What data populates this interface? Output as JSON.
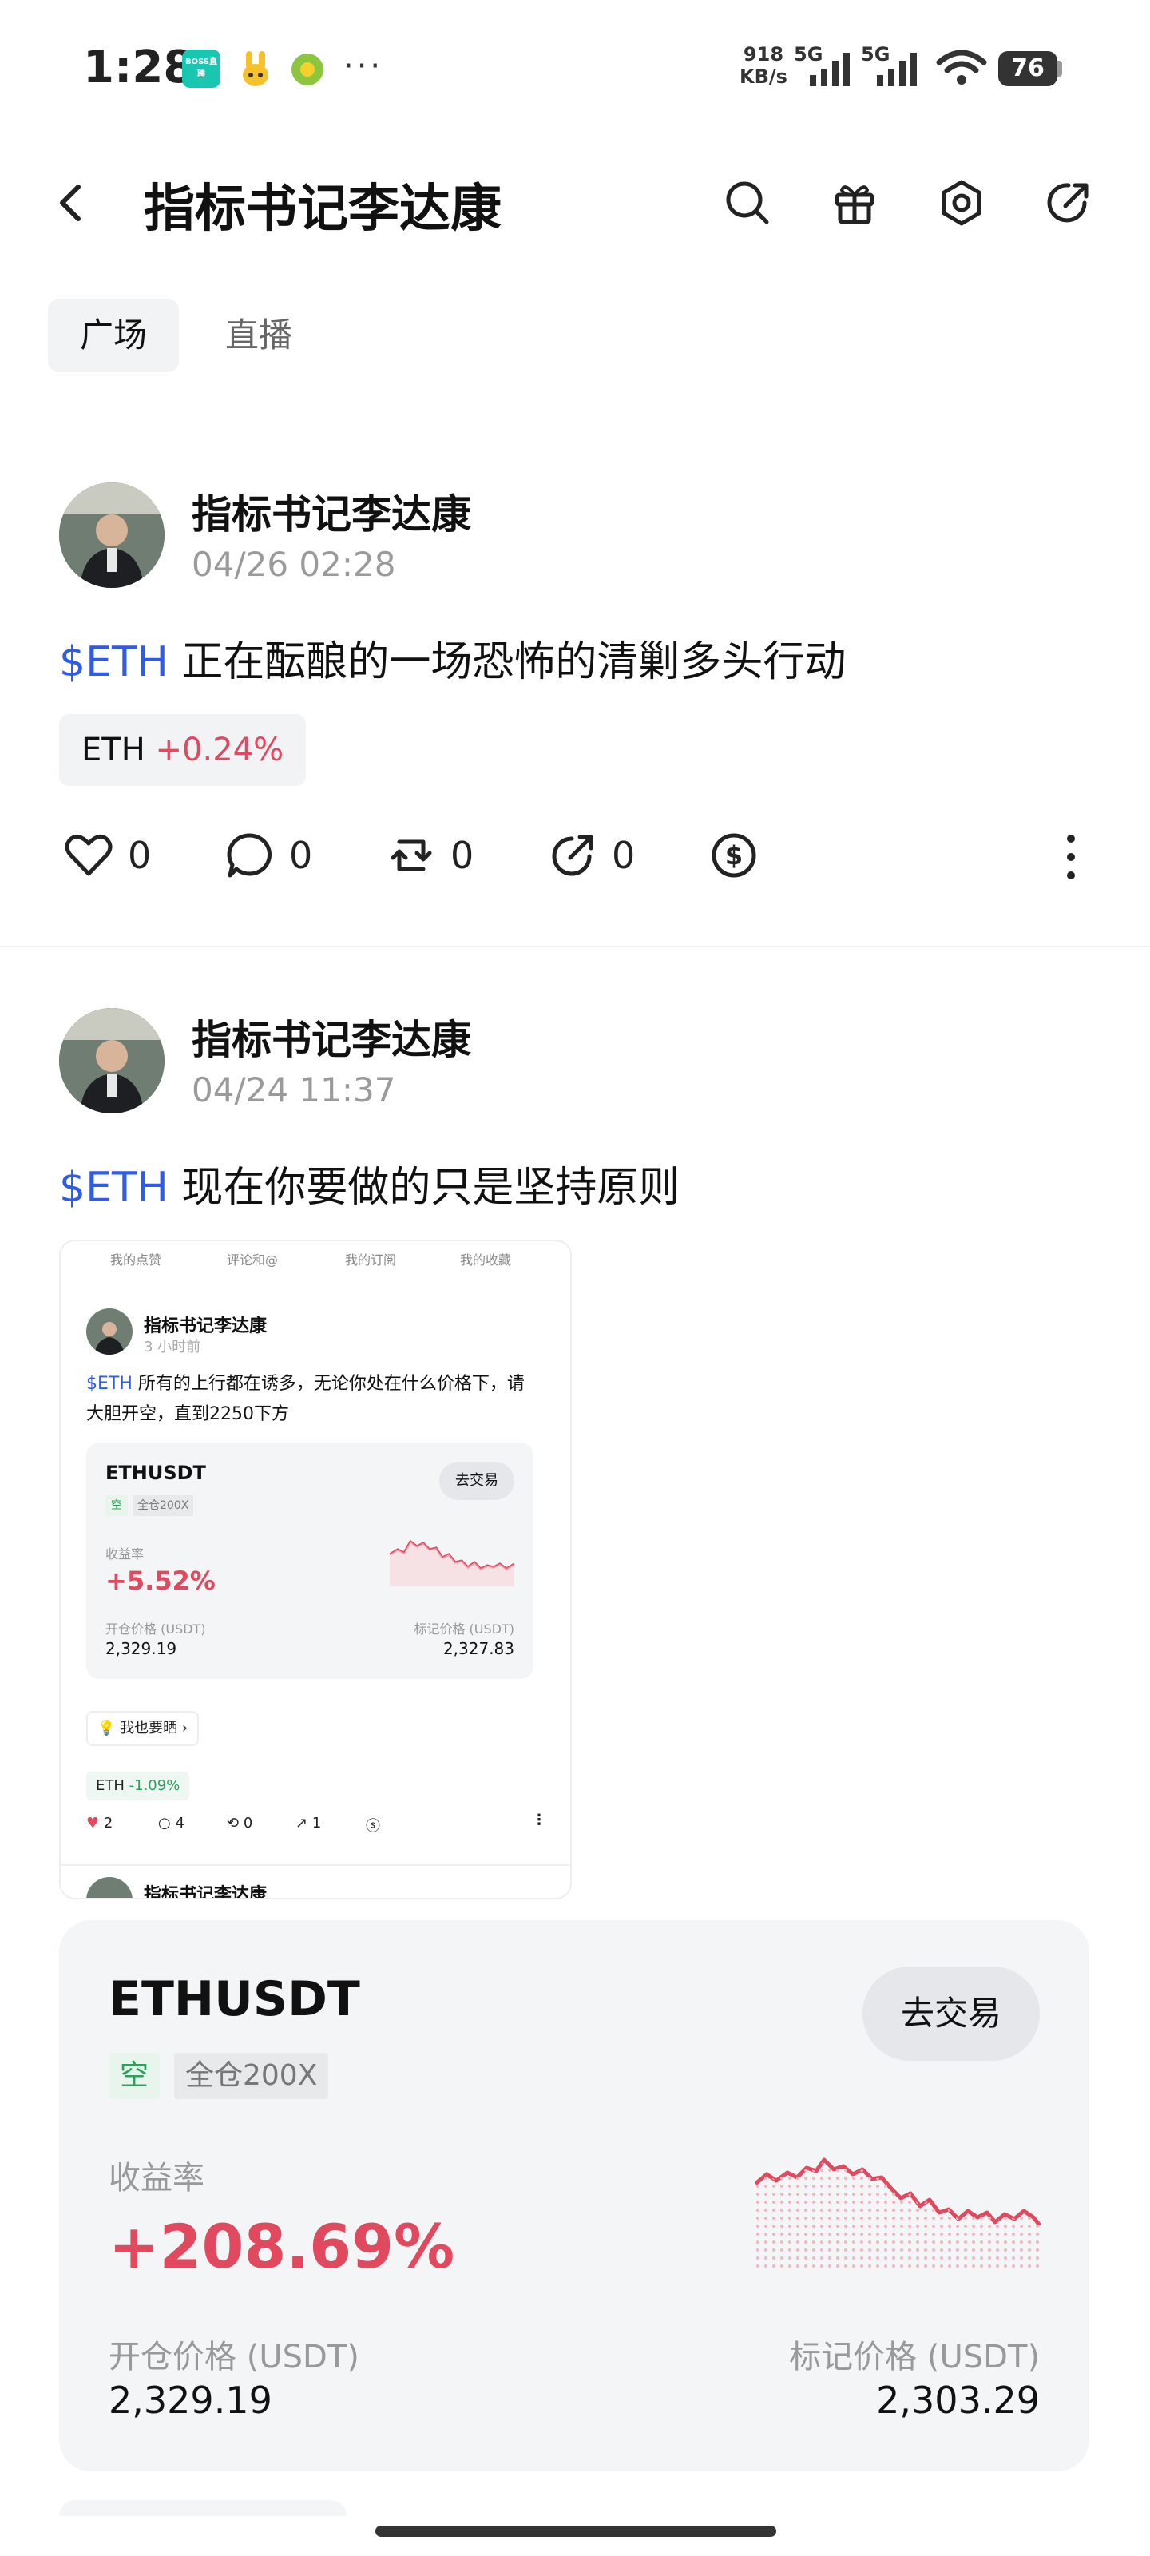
{
  "status_bar": {
    "time": "1:28",
    "apps": [
      "BOSS直聘",
      "rabbit-app",
      "green-app"
    ],
    "net_speed_value": "918",
    "net_speed_unit": "KB/s",
    "signal1": "5G",
    "signal2": "5G",
    "battery": "76"
  },
  "header": {
    "title": "指标书记李达康",
    "icons": [
      "back-icon",
      "search-icon",
      "gift-icon",
      "settings-icon",
      "share-icon"
    ]
  },
  "tabs": [
    "广场",
    "直播"
  ],
  "posts": [
    {
      "author": "指标书记李达康",
      "time": "04/26 02:28",
      "tag": "$ETH",
      "text": " 正在酝酿的一场恐怖的清剿多头行动",
      "chip_symbol": "ETH",
      "chip_change": "+0.24%",
      "likes": "0",
      "comments": "0",
      "reposts": "0",
      "shares": "0"
    },
    {
      "author": "指标书记李达康",
      "time": "04/24 11:37",
      "tag": "$ETH",
      "text": " 现在你要做的只是坚持原则"
    }
  ],
  "embedded_screenshot": {
    "tabs": [
      "我的点赞",
      "评论和@",
      "我的订阅",
      "我的收藏"
    ],
    "author": "指标书记李达康",
    "time": "3 小时前",
    "tag": "$ETH",
    "text": " 所有的上行都在诱多，无论你处在什么价格下，请大胆开空，直到2250下方",
    "card": {
      "symbol": "ETHUSDT",
      "button": "去交易",
      "side": "空",
      "leverage": "全仓200X",
      "roi_label": "收益率",
      "roi": "+5.52%",
      "open_label": "开仓价格 (USDT)",
      "open_price": "2,329.19",
      "mark_label": "标记价格 (USDT)",
      "mark_price": "2,327.83"
    },
    "share_label": "我也要晒",
    "chip_symbol": "ETH",
    "chip_change": "-1.09%",
    "likes": "2",
    "comments": "4",
    "reposts": "0",
    "shares": "1",
    "next_author": "指标书记李达康"
  },
  "position_card": {
    "symbol": "ETHUSDT",
    "button": "去交易",
    "side": "空",
    "leverage": "全仓200X",
    "roi_label": "收益率",
    "roi": "+208.69%",
    "open_label": "开仓价格 (USDT)",
    "open_price": "2,329.19",
    "mark_label": "标记价格 (USDT)",
    "mark_price": "2,303.29"
  },
  "colors": {
    "accent_blue": "#2f5bea",
    "up_red": "#e0495e",
    "short_green": "#2aa25b"
  }
}
